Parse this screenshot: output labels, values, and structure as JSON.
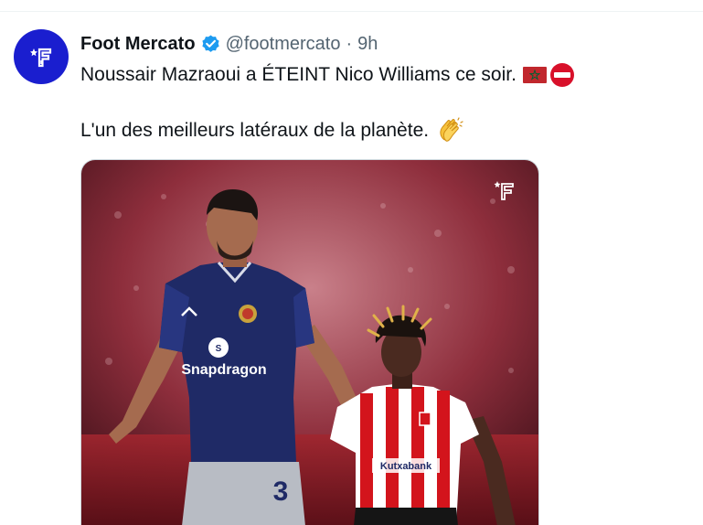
{
  "tweet": {
    "author_name": "Foot Mercato",
    "verified": true,
    "handle": "@footmercato",
    "separator": "·",
    "time": "9h",
    "text_line1": "Noussair Mazraoui a ÉTEINT Nico Williams ce soir.",
    "text_line2": "L'un des meilleurs latéraux de la planète.",
    "emojis_line1": [
      "flag-morocco",
      "no-entry"
    ],
    "emojis_line2": [
      "clapping-hands"
    ]
  },
  "media": {
    "jersey_sponsor": "Snapdragon",
    "jersey_number": "3",
    "opponent_sponsor": "Kutxabank"
  },
  "colors": {
    "avatar_bg": "#1a1ecf",
    "verified_blue": "#1d9bf0",
    "secondary_text": "#536471",
    "primary_text": "#0f1419",
    "united_navy": "#1f2a66",
    "athletic_red": "#d3141c"
  }
}
